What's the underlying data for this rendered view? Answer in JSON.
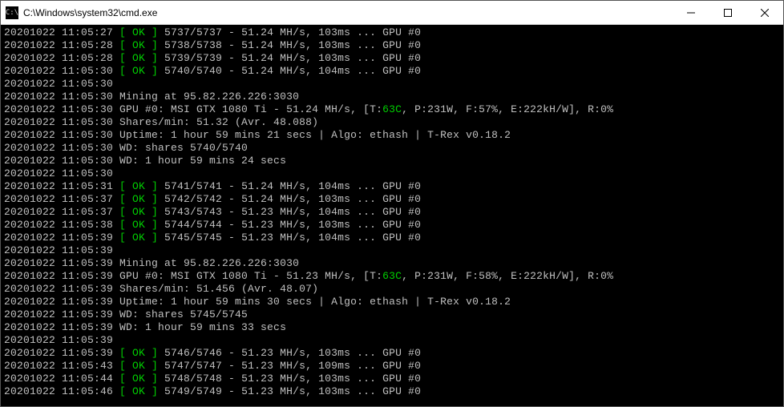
{
  "window": {
    "title": "C:\\Windows\\system32\\cmd.exe",
    "icon_label": "cmd-icon"
  },
  "lines": [
    {
      "ts": "20201022 11:05:27",
      "type": "ok",
      "shares": "5737/5737",
      "hash": "51.24",
      "ms": "103",
      "gpu": "GPU #0"
    },
    {
      "ts": "20201022 11:05:28",
      "type": "ok",
      "shares": "5738/5738",
      "hash": "51.24",
      "ms": "103",
      "gpu": "GPU #0"
    },
    {
      "ts": "20201022 11:05:28",
      "type": "ok",
      "shares": "5739/5739",
      "hash": "51.24",
      "ms": "103",
      "gpu": "GPU #0"
    },
    {
      "ts": "20201022 11:05:30",
      "type": "ok",
      "shares": "5740/5740",
      "hash": "51.24",
      "ms": "104",
      "gpu": "GPU #0"
    },
    {
      "ts": "20201022 11:05:30",
      "type": "blank"
    },
    {
      "ts": "20201022 11:05:30",
      "type": "plain",
      "text": "Mining at 95.82.226.226:3030"
    },
    {
      "ts": "20201022 11:05:30",
      "type": "gpustat",
      "prefix": "GPU #0: MSI GTX 1080 Ti - 51.24 MH/s, [T:",
      "temp": "63C",
      "suffix": ", P:231W, F:57%, E:222kH/W], R:0%"
    },
    {
      "ts": "20201022 11:05:30",
      "type": "plain",
      "text": "Shares/min: 51.32 (Avr. 48.088)"
    },
    {
      "ts": "20201022 11:05:30",
      "type": "plain",
      "text": "Uptime: 1 hour 59 mins 21 secs | Algo: ethash | T-Rex v0.18.2"
    },
    {
      "ts": "20201022 11:05:30",
      "type": "plain",
      "text": "WD: shares 5740/5740"
    },
    {
      "ts": "20201022 11:05:30",
      "type": "plain",
      "text": "WD: 1 hour 59 mins 24 secs"
    },
    {
      "ts": "20201022 11:05:30",
      "type": "blank"
    },
    {
      "ts": "20201022 11:05:31",
      "type": "ok",
      "shares": "5741/5741",
      "hash": "51.24",
      "ms": "104",
      "gpu": "GPU #0"
    },
    {
      "ts": "20201022 11:05:37",
      "type": "ok",
      "shares": "5742/5742",
      "hash": "51.24",
      "ms": "103",
      "gpu": "GPU #0"
    },
    {
      "ts": "20201022 11:05:37",
      "type": "ok",
      "shares": "5743/5743",
      "hash": "51.23",
      "ms": "104",
      "gpu": "GPU #0"
    },
    {
      "ts": "20201022 11:05:38",
      "type": "ok",
      "shares": "5744/5744",
      "hash": "51.23",
      "ms": "103",
      "gpu": "GPU #0"
    },
    {
      "ts": "20201022 11:05:39",
      "type": "ok",
      "shares": "5745/5745",
      "hash": "51.23",
      "ms": "104",
      "gpu": "GPU #0"
    },
    {
      "ts": "20201022 11:05:39",
      "type": "blank"
    },
    {
      "ts": "20201022 11:05:39",
      "type": "plain",
      "text": "Mining at 95.82.226.226:3030"
    },
    {
      "ts": "20201022 11:05:39",
      "type": "gpustat",
      "prefix": "GPU #0: MSI GTX 1080 Ti - 51.23 MH/s, [T:",
      "temp": "63C",
      "suffix": ", P:231W, F:58%, E:222kH/W], R:0%"
    },
    {
      "ts": "20201022 11:05:39",
      "type": "plain",
      "text": "Shares/min: 51.456 (Avr. 48.07)"
    },
    {
      "ts": "20201022 11:05:39",
      "type": "plain",
      "text": "Uptime: 1 hour 59 mins 30 secs | Algo: ethash | T-Rex v0.18.2"
    },
    {
      "ts": "20201022 11:05:39",
      "type": "plain",
      "text": "WD: shares 5745/5745"
    },
    {
      "ts": "20201022 11:05:39",
      "type": "plain",
      "text": "WD: 1 hour 59 mins 33 secs"
    },
    {
      "ts": "20201022 11:05:39",
      "type": "blank"
    },
    {
      "ts": "20201022 11:05:39",
      "type": "ok",
      "shares": "5746/5746",
      "hash": "51.23",
      "ms": "103",
      "gpu": "GPU #0"
    },
    {
      "ts": "20201022 11:05:43",
      "type": "ok",
      "shares": "5747/5747",
      "hash": "51.23",
      "ms": "109",
      "gpu": "GPU #0"
    },
    {
      "ts": "20201022 11:05:44",
      "type": "ok",
      "shares": "5748/5748",
      "hash": "51.23",
      "ms": "103",
      "gpu": "GPU #0"
    },
    {
      "ts": "20201022 11:05:46",
      "type": "ok",
      "shares": "5749/5749",
      "hash": "51.23",
      "ms": "103",
      "gpu": "GPU #0"
    }
  ],
  "tokens": {
    "ok_open": "[ ",
    "ok_label": "OK",
    "ok_close": " ]",
    "hash_unit": " MH/s, ",
    "ms_suffix": "ms ... "
  }
}
